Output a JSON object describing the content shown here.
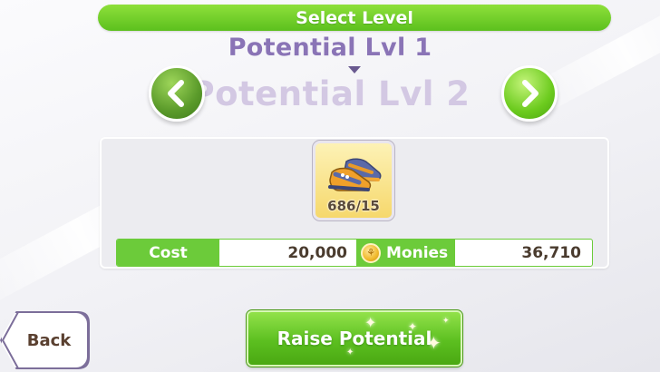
{
  "header": {
    "title": "Select Level"
  },
  "levels": {
    "previous": "Potential Lvl 1",
    "current": "Potential Lvl 2"
  },
  "item": {
    "icon": "shoes-icon",
    "count": "686/15"
  },
  "costs": {
    "cost_label": "Cost",
    "cost_value": "20,000",
    "monies_label": "Monies",
    "monies_value": "36,710",
    "coin_icon": "coin-icon"
  },
  "buttons": {
    "back_label": "Back",
    "raise_label": "Raise Potential"
  },
  "colors": {
    "accent_green": "#6ccb3a",
    "level_purple": "#8a74b6",
    "level_faded": "#d3c8e3"
  }
}
